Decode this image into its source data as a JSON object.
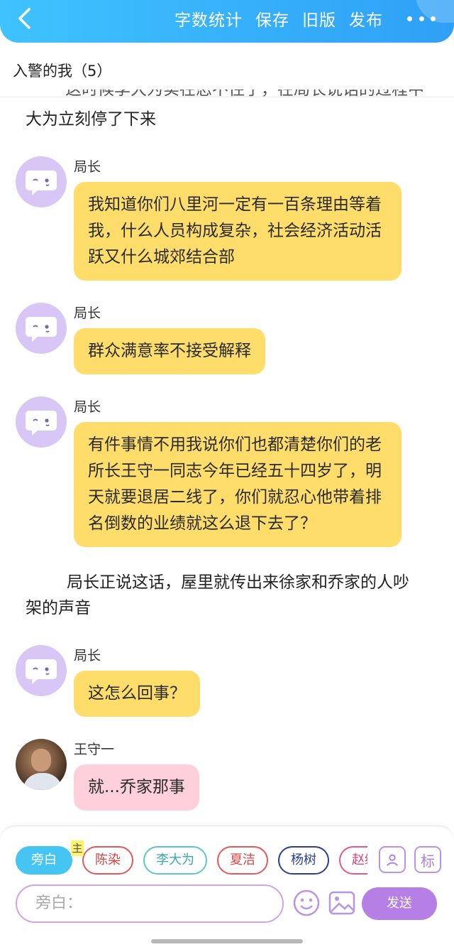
{
  "topbar": {
    "menu": [
      "字数统计",
      "保存",
      "旧版",
      "发布"
    ]
  },
  "chapter": {
    "title": "入警的我（5）"
  },
  "narration_cut": "这时候李大为实在忍不住了，在局长说话的过程中",
  "narration_top": "大为立刻停了下来",
  "messages": [
    {
      "sender": "局长",
      "text": "我知道你们八里河一定有一百条理由等着我，什么人员构成复杂，社会经济活动活跃又什么城郊结合部",
      "color": "yellow"
    },
    {
      "sender": "局长",
      "text": "群众满意率不接受解释",
      "color": "yellow"
    },
    {
      "sender": "局长",
      "text": "有件事情不用我说你们也都清楚你们的老所长王守一同志今年已经五十四岁了，明天就要退居二线了，你们就忍心他带着排名倒数的业绩就这么退下去了？",
      "color": "yellow"
    },
    {
      "sender": "局长",
      "text": "这怎么回事？",
      "color": "yellow"
    },
    {
      "sender": "王守一",
      "text": "就...乔家那事",
      "color": "pink"
    }
  ],
  "narration_mid": "局长正说这话，屋里就传出来徐家和乔家的人吵架的声音",
  "panel": {
    "chips": [
      "旁白",
      "陈染",
      "李大为",
      "夏洁",
      "杨树",
      "赵继伟"
    ],
    "main_tag": "主",
    "tool_mark": "标",
    "input_placeholder": "旁白：",
    "send_label": "发送"
  },
  "colors": {
    "accent": "#2fa0f6",
    "bubble_yellow": "#fedd6b",
    "bubble_pink": "#fdd0dc",
    "send": "#b57fe6"
  }
}
